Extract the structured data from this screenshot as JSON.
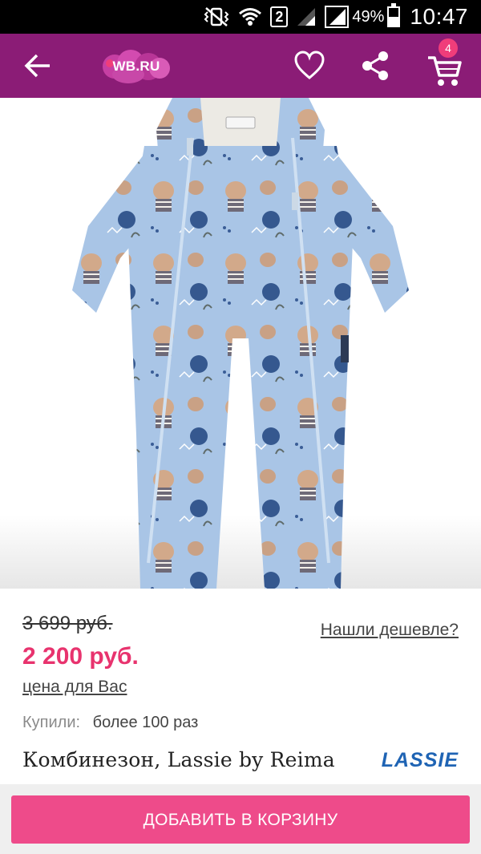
{
  "status_bar": {
    "sim_number": "2",
    "battery_level": "49%",
    "time": "10:47",
    "icons": [
      "vibrate-icon",
      "wifi-icon",
      "sim-icon",
      "signal-icon",
      "signal-2-icon",
      "battery-icon"
    ]
  },
  "app_bar": {
    "logo_text": "WB.RU",
    "cart_count": "4",
    "icons": [
      "back-arrow-icon",
      "heart-icon",
      "share-icon",
      "cart-icon"
    ],
    "colors": {
      "background": "#8b1c76",
      "badge": "#f03d7a"
    }
  },
  "gallery": {
    "image_count": 5,
    "active_index": 0,
    "product_label": "Lassie"
  },
  "product": {
    "old_price": "3 699 руб.",
    "new_price": "2 200 руб.",
    "price_for_you": "цена для Вас",
    "found_cheaper": "Нашли дешевле?",
    "bought_label": "Купили:",
    "bought_value": "более 100 раз",
    "title": "Комбинезон, Lassie by Reima",
    "brand_logo": "LASSIE",
    "colors": {
      "new_price": "#e8336e",
      "brand": "#1f64b4"
    }
  },
  "actions": {
    "add_to_cart": "ДОБАВИТЬ В КОРЗИНУ",
    "button_color": "#ee4b8a"
  }
}
